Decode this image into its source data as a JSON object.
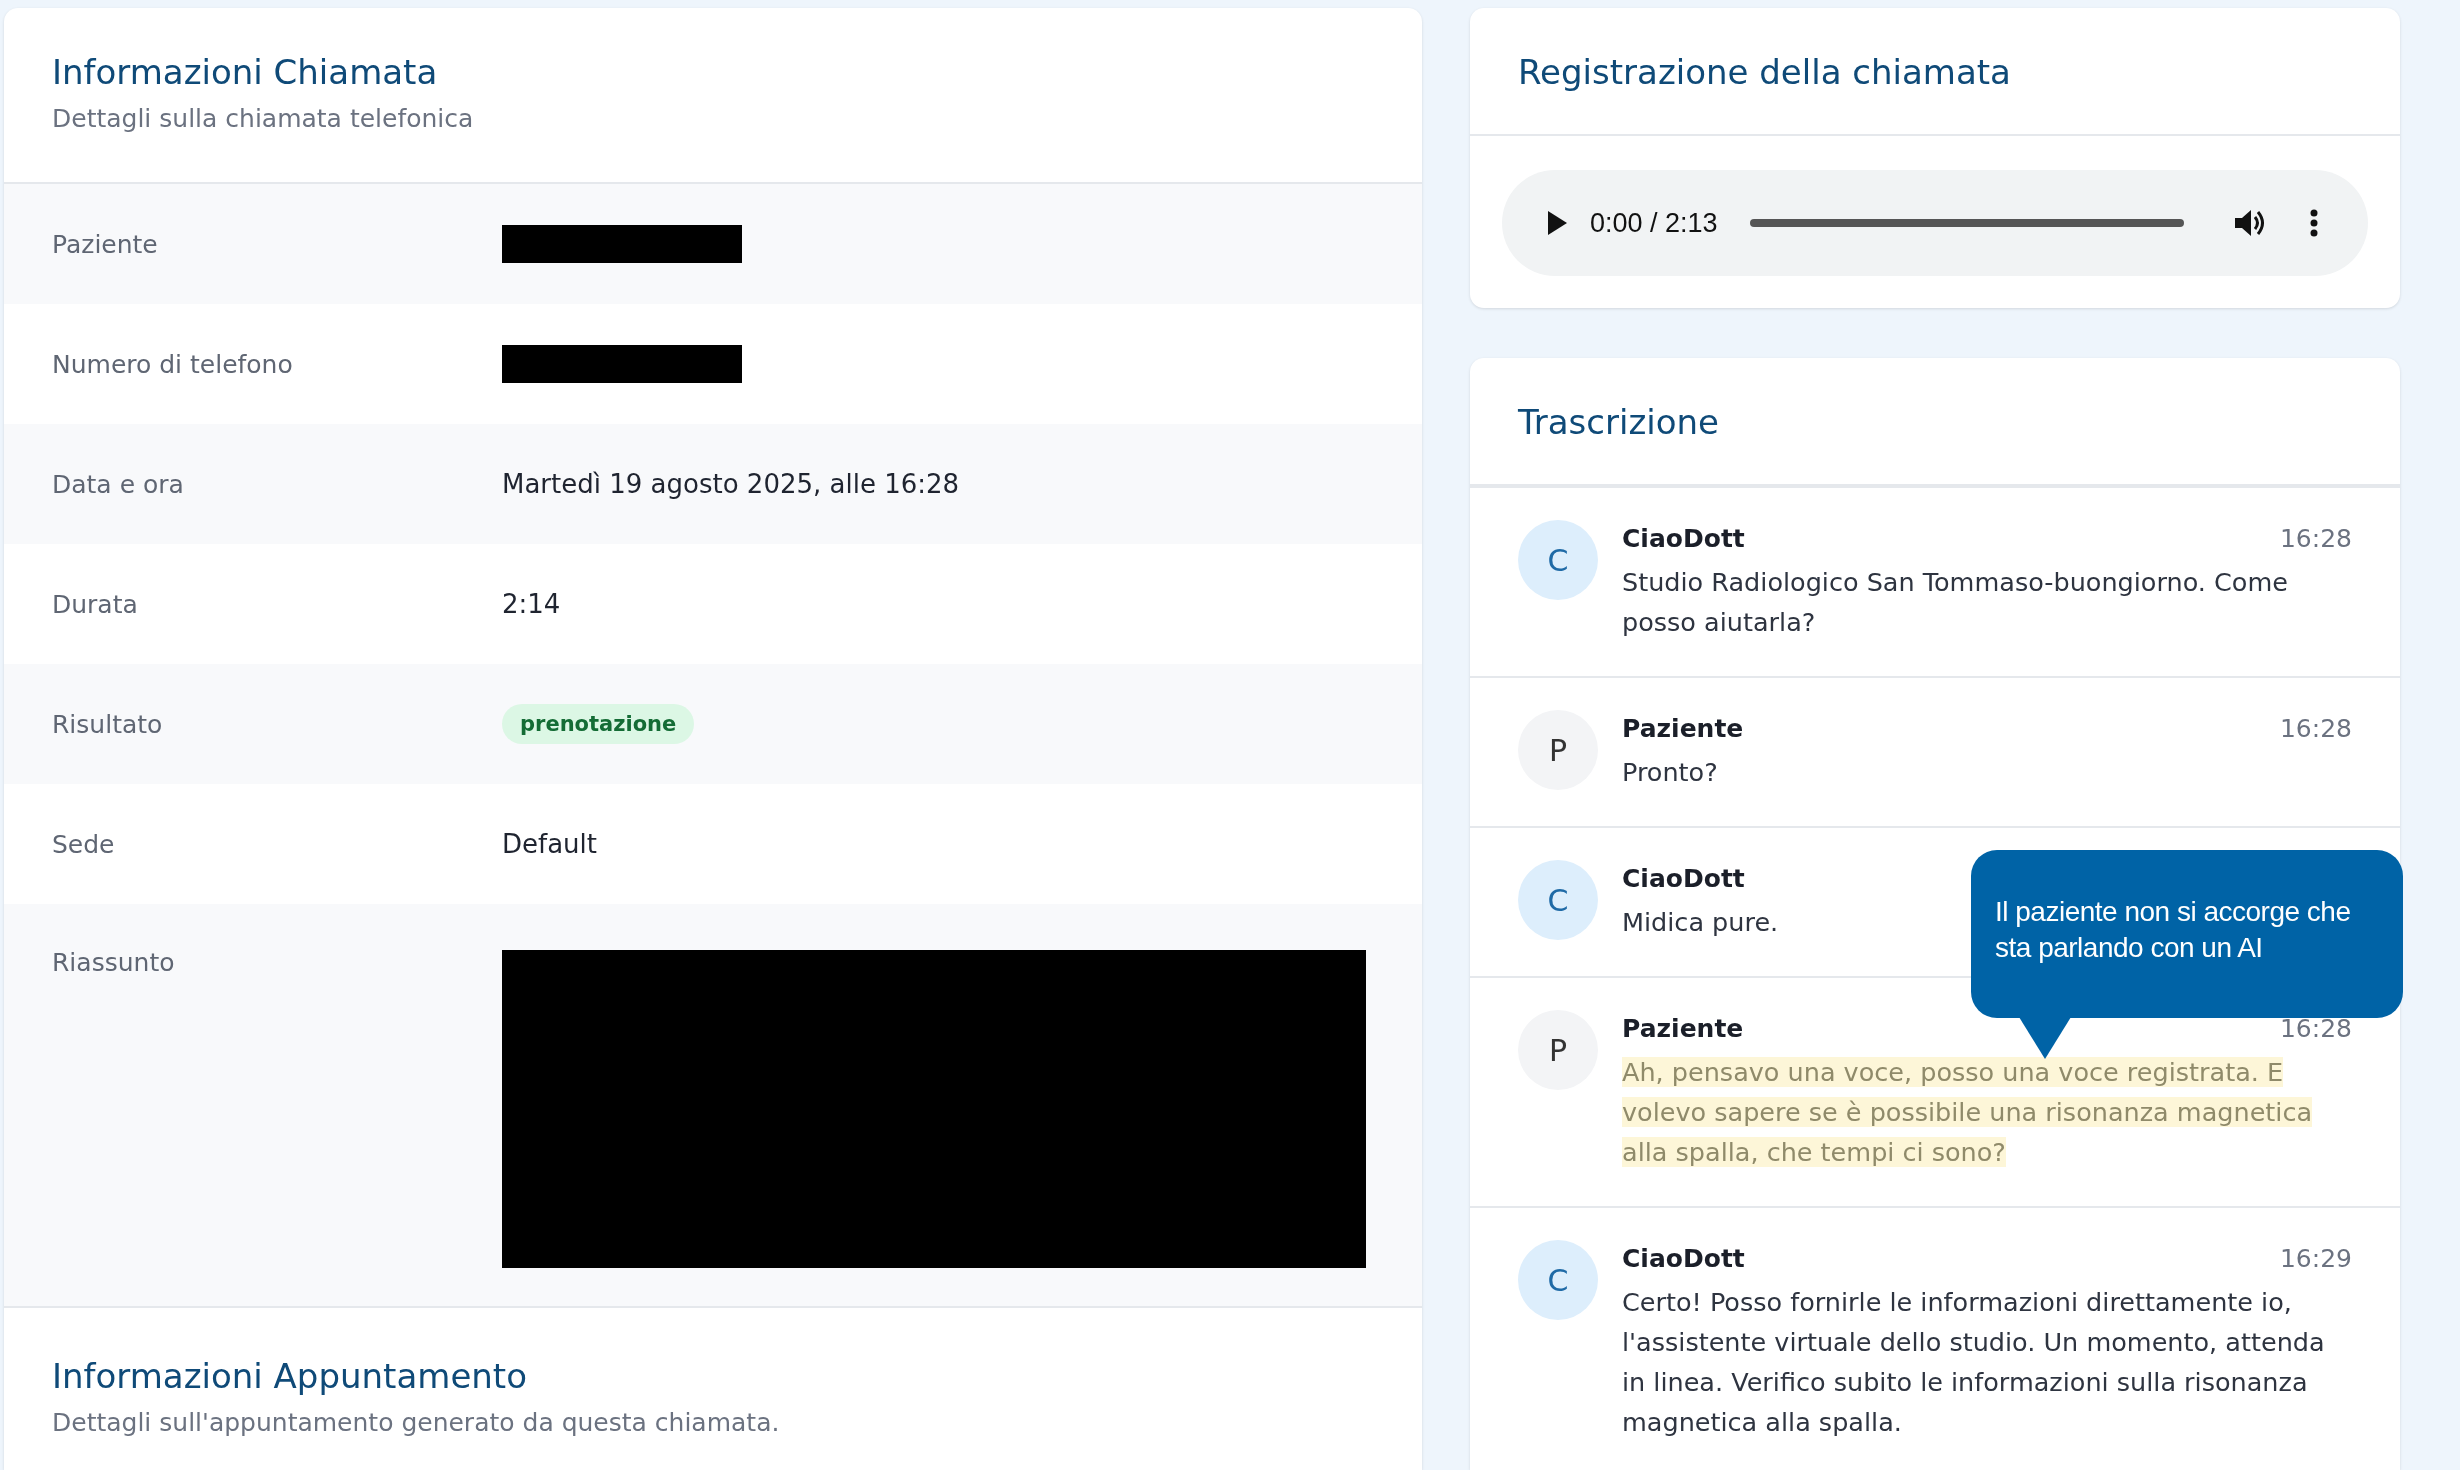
{
  "call_info": {
    "title": "Informazioni Chiamata",
    "subtitle": "Dettagli sulla chiamata telefonica",
    "rows": [
      {
        "label": "Paziente",
        "kind": "redacted"
      },
      {
        "label": "Numero di telefono",
        "kind": "redacted"
      },
      {
        "label": "Data e ora",
        "kind": "text",
        "value": "Martedì 19 agosto 2025, alle 16:28"
      },
      {
        "label": "Durata",
        "kind": "text",
        "value": "2:14"
      },
      {
        "label": "Risultato",
        "kind": "badge",
        "value": "prenotazione"
      },
      {
        "label": "Sede",
        "kind": "text",
        "value": "Default"
      },
      {
        "label": "Riassunto",
        "kind": "redacted_block"
      }
    ]
  },
  "appointment_info": {
    "title": "Informazioni Appuntamento",
    "subtitle": "Dettagli sull'appuntamento generato da questa chiamata."
  },
  "recording": {
    "title": "Registrazione della chiamata",
    "time": "0:00 / 2:13",
    "level": 0
  },
  "transcript": {
    "title": "Trascrizione",
    "messages": [
      {
        "kind": "assistant",
        "initial": "C",
        "speaker": "CiaoDott",
        "time": "16:28",
        "text": "Studio Radiologico San Tommaso-buongiorno. Come posso aiutarla?",
        "highlighted": false
      },
      {
        "kind": "patient",
        "initial": "P",
        "speaker": "Paziente",
        "time": "16:28",
        "text": "Pronto?",
        "highlighted": false
      },
      {
        "kind": "assistant",
        "initial": "C",
        "speaker": "CiaoDott",
        "text": "Midica pure.",
        "highlighted": false
      },
      {
        "kind": "patient",
        "initial": "P",
        "speaker": "Paziente",
        "time": "16:28",
        "text": "Ah, pensavo una voce, posso una voce registrata. E volevo sapere se è possibile una risonanza magnetica alla spalla, che tempi ci sono?",
        "highlighted": true
      },
      {
        "kind": "assistant",
        "initial": "C",
        "speaker": "CiaoDott",
        "time": "16:29",
        "text": "Certo! Posso fornirle le informazioni direttamente io, l'assistente virtuale dello studio. Un momento, attenda in linea. Verifico subito le informazioni sulla risonanza magnetica alla spalla.",
        "highlighted": false
      }
    ]
  },
  "callout": {
    "text": "Il paziente non si accorge che sta parlando con un AI"
  }
}
